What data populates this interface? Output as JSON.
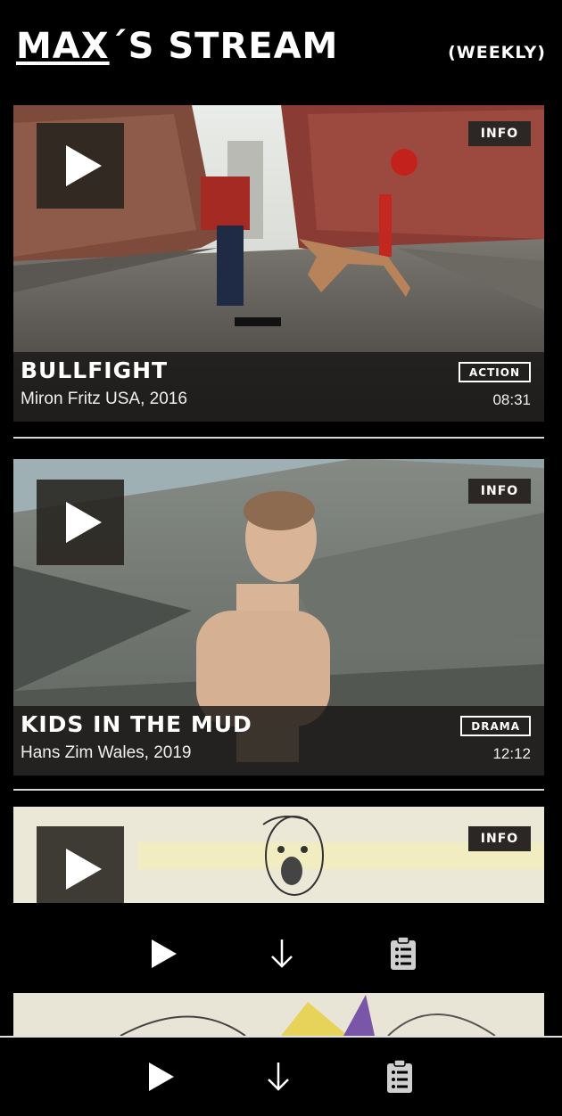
{
  "app": {
    "title_part1": "MAX",
    "title_part2": "´S STREAM",
    "period": "(WEEKLY)"
  },
  "feed": [
    {
      "title": "BULLFIGHT",
      "subtitle": "Miron Fritz USA, 2016",
      "genre": "ACTION",
      "duration": "08:31",
      "info_label": "INFO"
    },
    {
      "title": "KIDS IN THE MUD",
      "subtitle": "Hans Zim Wales, 2019",
      "genre": "DRAMA",
      "duration": "12:12",
      "info_label": "INFO"
    },
    {
      "info_label": "INFO"
    }
  ],
  "icons": {
    "play": "play-icon",
    "download": "download-arrow-icon",
    "notes": "clipboard-notes-icon"
  },
  "colors": {
    "background": "#000000",
    "caption_overlay": "#191716",
    "info_bg": "#2b2724",
    "text": "#ffffff"
  }
}
